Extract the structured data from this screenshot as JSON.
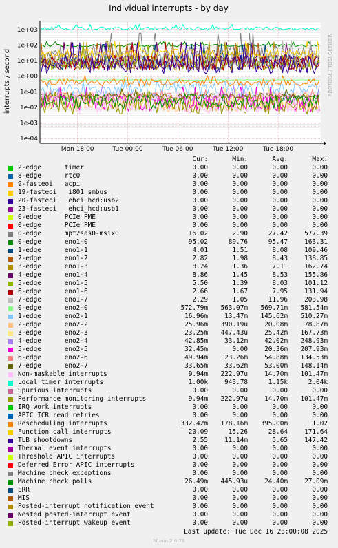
{
  "chart_data": {
    "type": "line",
    "title": "Individual interrupts - by day",
    "ylabel": "interrupts / second",
    "side_label": "RRDTOOL / TOBI OETIKER",
    "y_scale": "log",
    "ylim": [
      5e-05,
      3000
    ],
    "y_ticks": [
      "1e+03",
      "1e+02",
      "1e+01",
      "1e+00",
      "1e-01",
      "1e-02",
      "1e-03",
      "1e-04"
    ],
    "x_ticks": [
      "Mon 18:00",
      "Tue 00:00",
      "Tue 06:00",
      "Tue 12:00",
      "Tue 18:00"
    ],
    "grid": true,
    "legend_placement": "below",
    "columns": [
      "Cur:",
      "Min:",
      "Avg:",
      "Max:"
    ],
    "series": [
      {
        "name": "2-edge      timer",
        "color": "#00cc00",
        "values": [
          "0.00",
          "0.00",
          "0.00",
          "0.00"
        ]
      },
      {
        "name": "8-edge      rtc0",
        "color": "#0066b3",
        "values": [
          "0.00",
          "0.00",
          "0.00",
          "0.00"
        ]
      },
      {
        "name": "9-fasteoi   acpi",
        "color": "#ff8000",
        "values": [
          "0.00",
          "0.00",
          "0.00",
          "0.00"
        ]
      },
      {
        "name": "19-fasteoi   i801_smbus",
        "color": "#ffcc00",
        "values": [
          "0.00",
          "0.00",
          "0.00",
          "0.00"
        ]
      },
      {
        "name": "20-fasteoi   ehci_hcd:usb2",
        "color": "#330099",
        "values": [
          "0.00",
          "0.00",
          "0.00",
          "0.00"
        ]
      },
      {
        "name": "23-fasteoi   ehci_hcd:usb1",
        "color": "#990099",
        "values": [
          "0.00",
          "0.00",
          "0.00",
          "0.00"
        ]
      },
      {
        "name": "0-edge      PCIe PME",
        "color": "#ccff00",
        "values": [
          "0.00",
          "0.00",
          "0.00",
          "0.00"
        ]
      },
      {
        "name": "0-edge      PCIe PME",
        "color": "#ff0000",
        "values": [
          "0.00",
          "0.00",
          "0.00",
          "0.00"
        ]
      },
      {
        "name": "0-edge      mpt2sas0-msix0",
        "color": "#808080",
        "values": [
          "16.02",
          "2.90",
          "27.42",
          "577.39"
        ]
      },
      {
        "name": "0-edge      eno1-0",
        "color": "#008f00",
        "values": [
          "95.02",
          "89.76",
          "95.47",
          "163.31"
        ]
      },
      {
        "name": "1-edge      eno1-1",
        "color": "#00487d",
        "values": [
          "4.01",
          "1.51",
          "8.08",
          "109.46"
        ]
      },
      {
        "name": "2-edge      eno1-2",
        "color": "#b35a00",
        "values": [
          "2.82",
          "1.98",
          "8.43",
          "138.85"
        ]
      },
      {
        "name": "3-edge      eno1-3",
        "color": "#b38f00",
        "values": [
          "8.24",
          "1.36",
          "7.11",
          "162.74"
        ]
      },
      {
        "name": "4-edge      eno1-4",
        "color": "#6b006b",
        "values": [
          "8.86",
          "1.45",
          "8.53",
          "155.86"
        ]
      },
      {
        "name": "5-edge      eno1-5",
        "color": "#8fb300",
        "values": [
          "5.50",
          "1.39",
          "8.03",
          "101.12"
        ]
      },
      {
        "name": "6-edge      eno1-6",
        "color": "#b30000",
        "values": [
          "2.66",
          "1.67",
          "7.95",
          "131.94"
        ]
      },
      {
        "name": "7-edge      eno1-7",
        "color": "#bebebe",
        "values": [
          "2.29",
          "1.05",
          "11.96",
          "203.98"
        ]
      },
      {
        "name": "0-edge      eno2-0",
        "color": "#80ff80",
        "values": [
          "572.79m",
          "563.07m",
          "569.71m",
          "581.54m"
        ]
      },
      {
        "name": "1-edge      eno2-1",
        "color": "#80c9ff",
        "values": [
          "16.96m",
          "13.47m",
          "145.62m",
          "510.27m"
        ]
      },
      {
        "name": "2-edge      eno2-2",
        "color": "#ffc080",
        "values": [
          "25.96m",
          "390.19u",
          "20.08m",
          "78.87m"
        ]
      },
      {
        "name": "3-edge      eno2-3",
        "color": "#ffe680",
        "values": [
          "23.25m",
          "447.43u",
          "25.42m",
          "167.73m"
        ]
      },
      {
        "name": "4-edge      eno2-4",
        "color": "#aa80ff",
        "values": [
          "42.85m",
          "33.12m",
          "42.02m",
          "248.93m"
        ]
      },
      {
        "name": "5-edge      eno2-5",
        "color": "#ee00cc",
        "values": [
          "32.45m",
          "0.00",
          "20.36m",
          "207.93m"
        ]
      },
      {
        "name": "6-edge      eno2-6",
        "color": "#ff8080",
        "values": [
          "49.94m",
          "23.26m",
          "54.88m",
          "134.53m"
        ]
      },
      {
        "name": "7-edge      eno2-7",
        "color": "#666600",
        "values": [
          "33.65m",
          "33.62m",
          "53.00m",
          "148.14m"
        ]
      },
      {
        "name": "Non-maskable interrupts",
        "color": "#ffbfff",
        "values": [
          "9.94m",
          "222.97u",
          "14.70m",
          "101.47m"
        ]
      },
      {
        "name": "Local timer interrupts",
        "color": "#00ffcc",
        "values": [
          "1.00k",
          "943.78",
          "1.15k",
          "2.04k"
        ]
      },
      {
        "name": "Spurious interrupts",
        "color": "#cc6699",
        "values": [
          "0.00",
          "0.00",
          "0.00",
          "0.00"
        ]
      },
      {
        "name": "Performance monitoring interrupts",
        "color": "#999900",
        "values": [
          "9.94m",
          "222.97u",
          "14.70m",
          "101.47m"
        ]
      },
      {
        "name": "IRQ work interrupts",
        "color": "#00cc00",
        "values": [
          "0.00",
          "0.00",
          "0.00",
          "0.00"
        ]
      },
      {
        "name": "APIC ICR read retries",
        "color": "#0066b3",
        "values": [
          "0.00",
          "0.00",
          "0.00",
          "0.00"
        ]
      },
      {
        "name": "Rescheduling interrupts",
        "color": "#ff8000",
        "values": [
          "332.42m",
          "178.16m",
          "395.00m",
          "1.02"
        ]
      },
      {
        "name": "Function call interrupts",
        "color": "#ffcc00",
        "values": [
          "20.09",
          "15.26",
          "28.64",
          "171.64"
        ]
      },
      {
        "name": "TLB shootdowns",
        "color": "#330099",
        "values": [
          "2.55",
          "11.14m",
          "5.65",
          "147.42"
        ]
      },
      {
        "name": "Thermal event interrupts",
        "color": "#990099",
        "values": [
          "0.00",
          "0.00",
          "0.00",
          "0.00"
        ]
      },
      {
        "name": "Threshold APIC interrupts",
        "color": "#ccff00",
        "values": [
          "0.00",
          "0.00",
          "0.00",
          "0.00"
        ]
      },
      {
        "name": "Deferred Error APIC interrupts",
        "color": "#ff0000",
        "values": [
          "0.00",
          "0.00",
          "0.00",
          "0.00"
        ]
      },
      {
        "name": "Machine check exceptions",
        "color": "#808080",
        "values": [
          "0.00",
          "0.00",
          "0.00",
          "0.00"
        ]
      },
      {
        "name": "Machine check polls",
        "color": "#008f00",
        "values": [
          "26.49m",
          "445.93u",
          "24.40m",
          "27.09m"
        ]
      },
      {
        "name": "ERR",
        "color": "#00487d",
        "values": [
          "0.00",
          "0.00",
          "0.00",
          "0.00"
        ]
      },
      {
        "name": "MIS",
        "color": "#b35a00",
        "values": [
          "0.00",
          "0.00",
          "0.00",
          "0.00"
        ]
      },
      {
        "name": "Posted-interrupt notification event",
        "color": "#b38f00",
        "values": [
          "0.00",
          "0.00",
          "0.00",
          "0.00"
        ]
      },
      {
        "name": "Nested posted-interrupt event",
        "color": "#6b006b",
        "values": [
          "0.00",
          "0.00",
          "0.00",
          "0.00"
        ]
      },
      {
        "name": "Posted-interrupt wakeup event",
        "color": "#8fb300",
        "values": [
          "0.00",
          "0.00",
          "0.00",
          "0.00"
        ]
      }
    ]
  },
  "footer": {
    "last_update": "Last update: Tue Dec 16 23:00:08 2025",
    "version": "Munin 2.0.76"
  }
}
